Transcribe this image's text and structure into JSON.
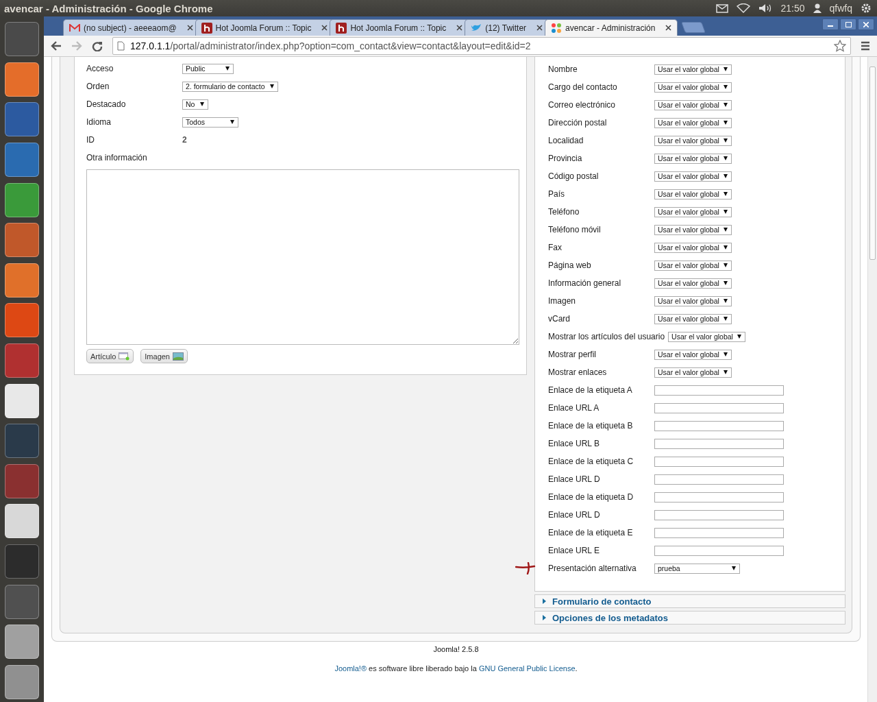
{
  "window": {
    "title": "avencar - Administración - Google Chrome"
  },
  "top_panel": {
    "clock": "21:50",
    "user": "qfwfq"
  },
  "launcher": [
    {
      "kind": "ubuntu"
    },
    {
      "kind": "files"
    },
    {
      "kind": "firefox"
    },
    {
      "kind": "writer"
    },
    {
      "kind": "calc"
    },
    {
      "kind": "impress"
    },
    {
      "kind": "store"
    },
    {
      "kind": "ubuntu-one"
    },
    {
      "kind": "settings"
    },
    {
      "kind": "chrome"
    },
    {
      "kind": "lightroom"
    },
    {
      "kind": "wine"
    },
    {
      "kind": "editor"
    },
    {
      "kind": "terminal"
    },
    {
      "kind": "workspaces"
    },
    {
      "kind": "disk"
    },
    {
      "kind": "trash"
    }
  ],
  "tabs": [
    {
      "title": "(no subject) - aeeeaom@",
      "kind": "mail",
      "selected": false
    },
    {
      "title": "Hot Joomla Forum :: Topic",
      "kind": "h",
      "selected": false
    },
    {
      "title": "Hot Joomla Forum :: Topic",
      "kind": "h",
      "selected": false
    },
    {
      "title": "(12) Twitter",
      "kind": "bird",
      "selected": false
    },
    {
      "title": "avencar - Administración",
      "kind": "joomla",
      "selected": true
    }
  ],
  "address_bar": {
    "host": "127.0.1.1",
    "path": "/portal/administrator/index.php?option=com_contact&view=contact&layout=edit&id=2"
  },
  "left_fields": [
    {
      "label": "Acceso",
      "kind": "select",
      "value": "Public"
    },
    {
      "label": "Orden",
      "kind": "select",
      "value": "2. formulario de contacto"
    },
    {
      "label": "Destacado",
      "kind": "select",
      "value": "No"
    },
    {
      "label": "Idioma",
      "kind": "select",
      "value": "Todos"
    },
    {
      "label": "ID",
      "kind": "static",
      "value": "2"
    },
    {
      "label": "Otra información",
      "kind": "none"
    }
  ],
  "editor_buttons": [
    {
      "label": "Artículo",
      "kind": "article"
    },
    {
      "label": "Imagen",
      "kind": "image"
    }
  ],
  "right_fields": [
    {
      "label": "Nombre",
      "kind": "select",
      "value": "Usar el valor global",
      "annotated": false
    },
    {
      "label": "Cargo del contacto",
      "kind": "select",
      "value": "Usar el valor global",
      "annotated": false
    },
    {
      "label": "Correo electrónico",
      "kind": "select",
      "value": "Usar el valor global",
      "annotated": false
    },
    {
      "label": "Dirección postal",
      "kind": "select",
      "value": "Usar el valor global",
      "annotated": false
    },
    {
      "label": "Localidad",
      "kind": "select",
      "value": "Usar el valor global",
      "annotated": false
    },
    {
      "label": "Provincia",
      "kind": "select",
      "value": "Usar el valor global",
      "annotated": false
    },
    {
      "label": "Código postal",
      "kind": "select",
      "value": "Usar el valor global",
      "annotated": false
    },
    {
      "label": "País",
      "kind": "select",
      "value": "Usar el valor global",
      "annotated": false
    },
    {
      "label": "Teléfono",
      "kind": "select",
      "value": "Usar el valor global",
      "annotated": false
    },
    {
      "label": "Teléfono móvil",
      "kind": "select",
      "value": "Usar el valor global",
      "annotated": false
    },
    {
      "label": "Fax",
      "kind": "select",
      "value": "Usar el valor global",
      "annotated": false
    },
    {
      "label": "Página web",
      "kind": "select",
      "value": "Usar el valor global",
      "annotated": false
    },
    {
      "label": "Información general",
      "kind": "select",
      "value": "Usar el valor global",
      "annotated": false
    },
    {
      "label": "Imagen",
      "kind": "select",
      "value": "Usar el valor global",
      "annotated": false
    },
    {
      "label": "vCard",
      "kind": "select",
      "value": "Usar el valor global",
      "annotated": false
    },
    {
      "label": "Mostrar los artículos del usuario",
      "kind": "select",
      "value": "Usar el valor global",
      "annotated": false
    },
    {
      "label": "Mostrar perfil",
      "kind": "select",
      "value": "Usar el valor global",
      "annotated": false
    },
    {
      "label": "Mostrar enlaces",
      "kind": "select",
      "value": "Usar el valor global",
      "annotated": false
    },
    {
      "label": "Enlace de la etiqueta A",
      "kind": "text",
      "annotated": false
    },
    {
      "label": "Enlace URL A",
      "kind": "text",
      "annotated": false
    },
    {
      "label": "Enlace de la etiqueta B",
      "kind": "text",
      "annotated": false
    },
    {
      "label": "Enlace URL B",
      "kind": "text",
      "annotated": false
    },
    {
      "label": "Enlace de la etiqueta C",
      "kind": "text",
      "annotated": false
    },
    {
      "label": "Enlace URL D",
      "kind": "text",
      "annotated": false
    },
    {
      "label": "Enlace de la etiqueta D",
      "kind": "text",
      "annotated": false
    },
    {
      "label": "Enlace URL D",
      "kind": "text",
      "annotated": false
    },
    {
      "label": "Enlace de la etiqueta E",
      "kind": "text",
      "annotated": false
    },
    {
      "label": "Enlace URL E",
      "kind": "text",
      "annotated": false
    },
    {
      "label": "Presentación alternativa",
      "kind": "select-wide",
      "value": "prueba",
      "annotated": true
    }
  ],
  "panels": [
    {
      "title": "Formulario de contacto",
      "expanded": false
    },
    {
      "title": "Opciones de los metadatos",
      "expanded": false
    }
  ],
  "footer": {
    "version": "Joomla! 2.5.8",
    "link_1": "Joomla!®",
    "text": "es software libre liberado bajo la",
    "link_2": "GNU General Public License",
    "end": "."
  }
}
